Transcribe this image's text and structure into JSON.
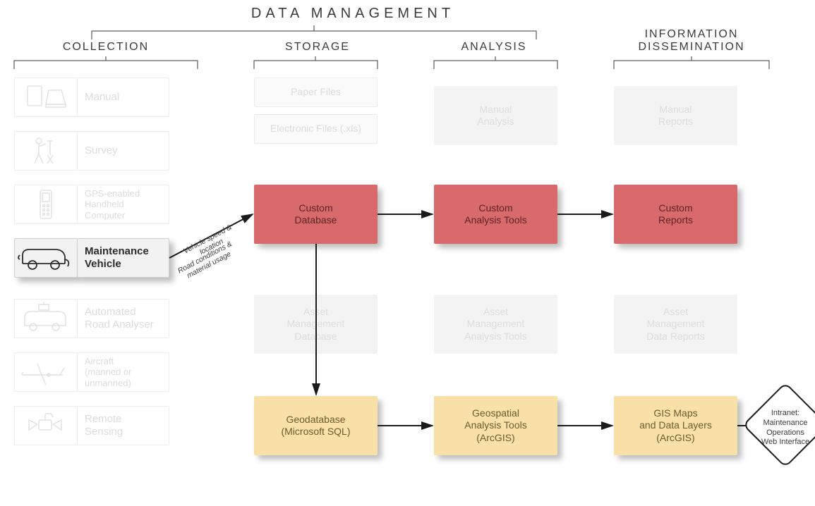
{
  "title": "DATA  MANAGEMENT",
  "columns": {
    "collection": "COLLECTION",
    "storage": "STORAGE",
    "analysis": "ANALYSIS",
    "dissemination": "INFORMATION\nDISSEMINATION"
  },
  "collection_items": {
    "manual": "Manual",
    "survey": "Survey",
    "gps": "GPS-enabled\nHandheld\nComputer",
    "maint": "Maintenance\nVehicle",
    "analyser": "Automated\nRoad Analyser",
    "aircraft": "Aircraft\n(manned or\nunmanned)",
    "remote": "Remote\nSensing"
  },
  "storage": {
    "paper": "Paper Files",
    "elec": "Electronic Files (.xls)",
    "custom_db": "Custom\nDatabase",
    "asset_db": "Asset\nManagement\nDatabase",
    "geodb": "Geodatabase\n(Microsoft SQL)"
  },
  "analysis": {
    "manual": "Manual\nAnalysis",
    "custom": "Custom\nAnalysis Tools",
    "asset": "Asset\nManagement\nAnalysis Tools",
    "geo": "Geospatial\nAnalysis Tools\n(ArcGIS)"
  },
  "dissemination": {
    "manual": "Manual\nReports",
    "custom": "Custom\nReports",
    "asset": "Asset\nManagement\nData Reports",
    "gis": "GIS Maps\nand Data Layers\n(ArcGIS)"
  },
  "flow_labels": {
    "l1": "Vehicle speed &\nlocation",
    "l2": "Road conditions &\nmaterial usage"
  },
  "intranet": "Intranet:\nMaintenance\nOperations\nWeb Interface"
}
